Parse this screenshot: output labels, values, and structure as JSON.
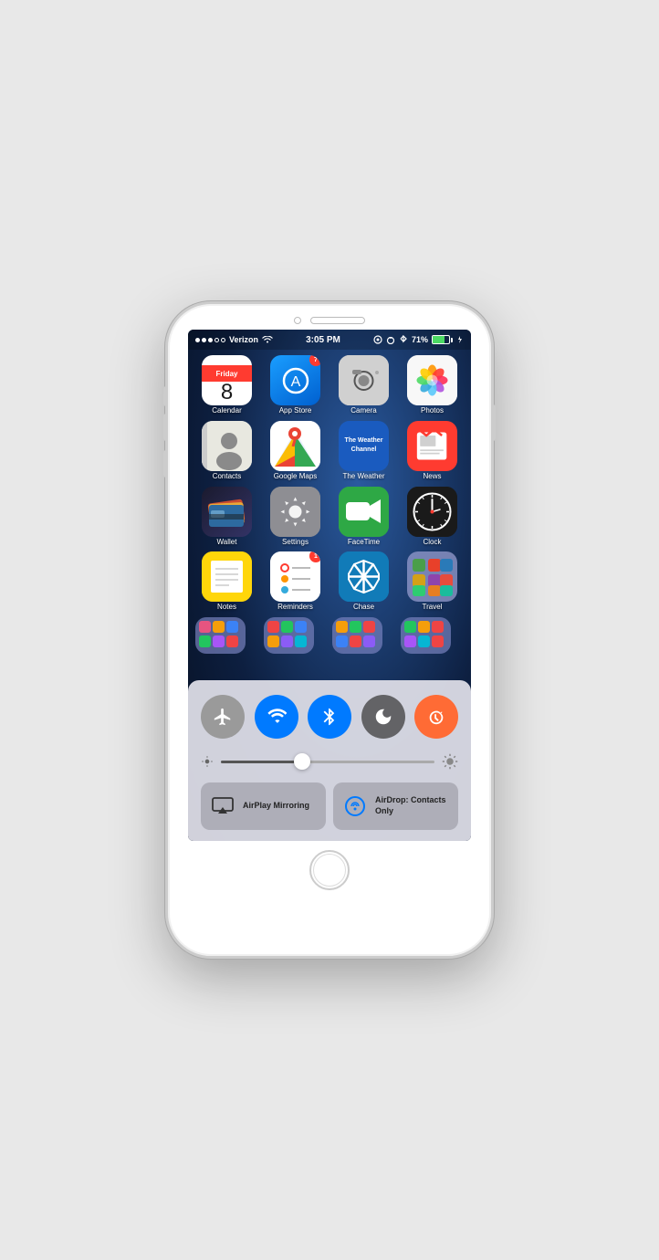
{
  "phone": {
    "status_bar": {
      "carrier": "Verizon",
      "time": "3:05 PM",
      "battery_pct": "71%",
      "wifi": true,
      "bluetooth": true
    },
    "apps": [
      {
        "id": "calendar",
        "label": "Calendar",
        "badge": null,
        "day": "Friday",
        "date": "8"
      },
      {
        "id": "appstore",
        "label": "App Store",
        "badge": "7"
      },
      {
        "id": "camera",
        "label": "Camera",
        "badge": null
      },
      {
        "id": "photos",
        "label": "Photos",
        "badge": null
      },
      {
        "id": "contacts",
        "label": "Contacts",
        "badge": null
      },
      {
        "id": "googlemaps",
        "label": "Google Maps",
        "badge": null
      },
      {
        "id": "weather",
        "label": "The Weather",
        "badge": null,
        "line1": "The Weather",
        "line2": "Channel"
      },
      {
        "id": "news",
        "label": "News",
        "badge": null
      },
      {
        "id": "wallet",
        "label": "Wallet",
        "badge": null
      },
      {
        "id": "settings",
        "label": "Settings",
        "badge": null
      },
      {
        "id": "facetime",
        "label": "FaceTime",
        "badge": null
      },
      {
        "id": "clock",
        "label": "Clock",
        "badge": null
      },
      {
        "id": "notes",
        "label": "Notes",
        "badge": null
      },
      {
        "id": "reminders",
        "label": "Reminders",
        "badge": "1"
      },
      {
        "id": "chase",
        "label": "Chase",
        "badge": null
      },
      {
        "id": "travel",
        "label": "Travel",
        "badge": null
      }
    ],
    "control_center": {
      "airplane_label": "Airplane Mode",
      "wifi_label": "Wi-Fi",
      "bluetooth_label": "Bluetooth",
      "donotdisturb_label": "Do Not Disturb",
      "rotation_label": "Rotation Lock",
      "brightness_pct": 38,
      "airplay_label": "AirPlay Mirroring",
      "airdrop_label": "AirDrop: Contacts Only"
    }
  }
}
